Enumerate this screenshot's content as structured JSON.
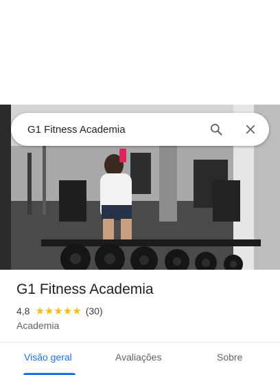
{
  "search": {
    "query": "G1 Fitness Academia"
  },
  "photo": {
    "subject": "gym-interior-photo"
  },
  "place": {
    "name": "G1 Fitness Academia",
    "rating": "4,8",
    "stars": 5,
    "reviews": "(30)",
    "category": "Academia"
  },
  "tabs": [
    {
      "label": "Visão geral",
      "active": true
    },
    {
      "label": "Avaliações",
      "active": false
    },
    {
      "label": "Sobre",
      "active": false
    }
  ],
  "colors": {
    "accent": "#1a73e8",
    "star": "#fbbc04",
    "text": "#202124",
    "secondary": "#5f6368"
  }
}
